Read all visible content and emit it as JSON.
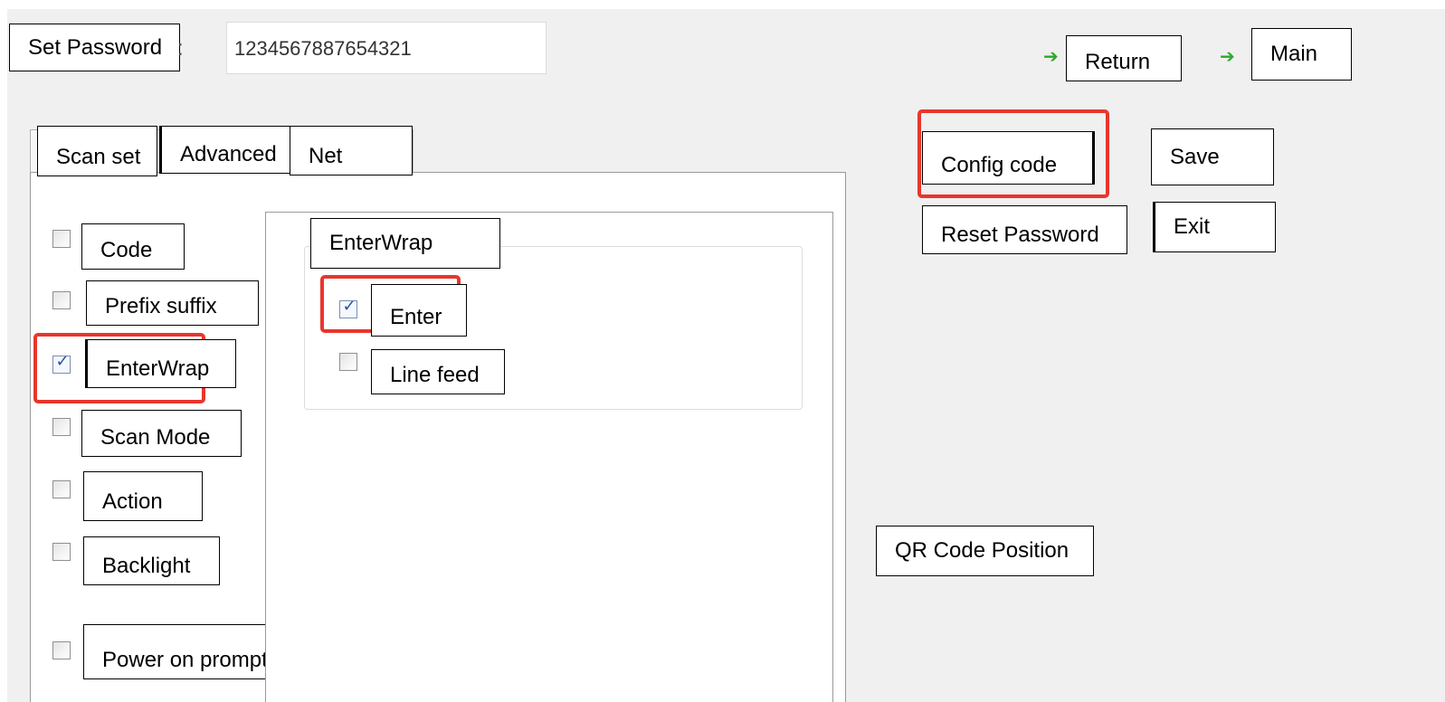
{
  "header": {
    "set_password_label": "Set Password",
    "colon": ":",
    "password_value": "1234567887654321",
    "return_label": "Return",
    "main_label": "Main",
    "arrow_icon": "green-arrow-icon"
  },
  "tabs": [
    {
      "label": "Scan set",
      "active": true
    },
    {
      "label": "Advanced",
      "active": false
    },
    {
      "label": "Net",
      "active": false
    }
  ],
  "options": [
    {
      "label": "Code",
      "checked": false
    },
    {
      "label": "Prefix suffix",
      "checked": false
    },
    {
      "label": "EnterWrap",
      "checked": true
    },
    {
      "label": "Scan Mode",
      "checked": false
    },
    {
      "label": "Action",
      "checked": false
    },
    {
      "label": "Backlight",
      "checked": false
    },
    {
      "label": "Power on prompt",
      "checked": false
    }
  ],
  "enterwrap_group": {
    "title": "EnterWrap",
    "items": [
      {
        "label": "Enter",
        "checked": true
      },
      {
        "label": "Line feed",
        "checked": false
      }
    ]
  },
  "actions": {
    "config_code": "Config code",
    "save": "Save",
    "reset_password": "Reset Password",
    "exit": "Exit",
    "qr_position": "QR Code Position"
  },
  "colors": {
    "highlight": "#e8362c",
    "arrow": "#2aaa2a",
    "window_bg": "#f0f0f0"
  }
}
